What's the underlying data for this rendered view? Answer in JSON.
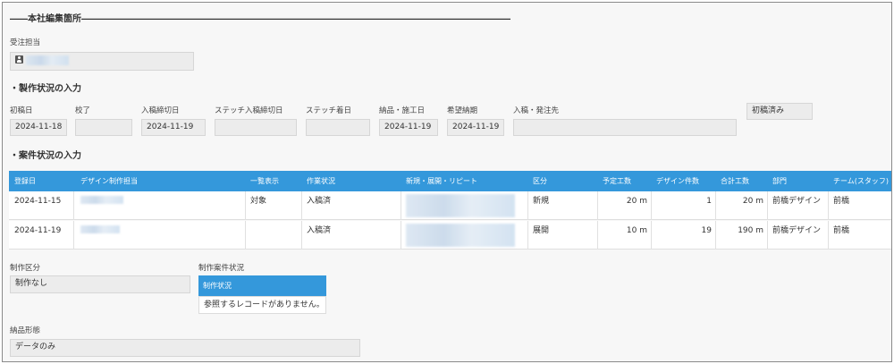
{
  "header": {
    "title": "――本社編集箇所――――――――――――――――――――――――――――――――――――――――――――――――"
  },
  "order_owner": {
    "label": "受注担当",
    "icon": "user-icon"
  },
  "production_status": {
    "title": "・製作状況の入力",
    "fields": [
      {
        "label": "初稿日",
        "value": "2024-11-18"
      },
      {
        "label": "校了",
        "value": ""
      },
      {
        "label": "入稿締切日",
        "value": "2024-11-19"
      },
      {
        "label": "ステッチ入稿締切日",
        "value": ""
      },
      {
        "label": "ステッチ着日",
        "value": ""
      },
      {
        "label": "納品・施工日",
        "value": "2024-11-19"
      },
      {
        "label": "希望納期",
        "value": "2024-11-19"
      },
      {
        "label": "入稿・発注先",
        "value": ""
      }
    ],
    "status_badge": "初稿済み"
  },
  "case_status": {
    "title": "・案件状況の入力",
    "columns": [
      "登録日",
      "デザイン制作担当",
      "一覧表示",
      "作業状況",
      "新規・展開・リピート",
      "区分",
      "予定工数",
      "デザイン件数",
      "合計工数",
      "部門",
      "チーム(スタッフ)"
    ],
    "rows": [
      {
        "date": "2024-11-15",
        "display": "対象",
        "work_status": "入稿済",
        "category": "新規",
        "planned": "20 m",
        "count": "1",
        "total": "20 m",
        "dept": "前橋デザイン",
        "team": "前橋"
      },
      {
        "date": "2024-11-19",
        "display": "",
        "work_status": "入稿済",
        "category": "展開",
        "planned": "10 m",
        "count": "19",
        "total": "190 m",
        "dept": "前橋デザイン",
        "team": "前橋"
      }
    ]
  },
  "production_type": {
    "label": "制作区分",
    "value": "制作なし"
  },
  "production_case_status": {
    "label": "制作案件状況",
    "header": "制作状況",
    "empty_message": "参照するレコードがありません。"
  },
  "delivery_format": {
    "label": "納品形態",
    "value": "データのみ"
  },
  "colors": {
    "accent": "#3498db",
    "field_bg": "#ececec",
    "page_bg": "#f7f7f7"
  }
}
